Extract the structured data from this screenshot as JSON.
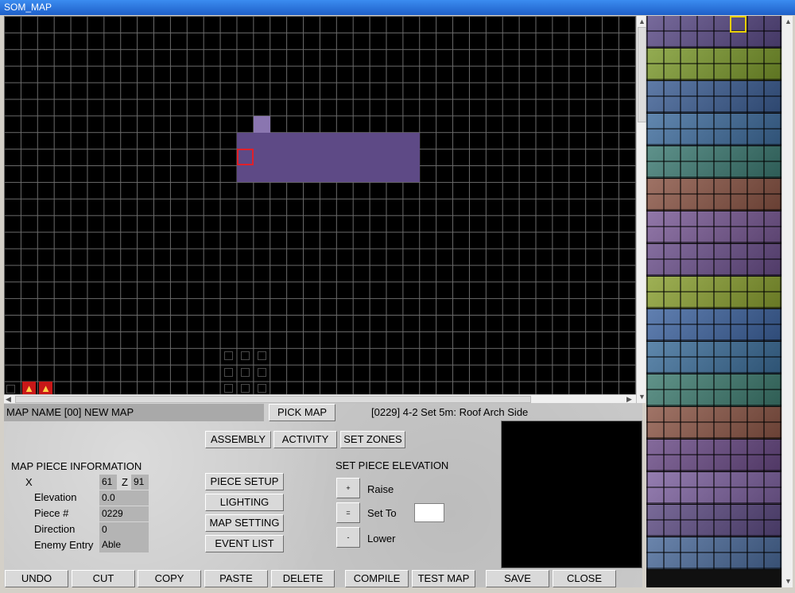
{
  "window": {
    "title": "SOM_MAP"
  },
  "map": {
    "name_label": "MAP NAME [00] NEW MAP",
    "pick_label": "PICK MAP",
    "piece_caption": "[0229] 4-2 Set 5m: Roof Arch Side"
  },
  "modes": [
    "ASSEMBLY",
    "ACTIVITY",
    "SET ZONES"
  ],
  "info": {
    "heading": "MAP PIECE INFORMATION",
    "x_label": "X",
    "x_value": "61",
    "z_label": "Z",
    "z_value": "91",
    "elevation_label": "Elevation",
    "elevation_value": "0.0",
    "piece_label": "Piece #",
    "piece_value": "0229",
    "direction_label": "Direction",
    "direction_value": "0",
    "enemy_label": "Enemy Entry",
    "enemy_value": "Able"
  },
  "side_buttons": [
    "PIECE SETUP",
    "LIGHTING",
    "MAP SETTING",
    "EVENT LIST"
  ],
  "elevation": {
    "heading": "SET PIECE ELEVATION",
    "raise": "Raise",
    "set_to": "Set To",
    "lower": "Lower",
    "raise_symbol": "+",
    "set_symbol": "=",
    "lower_symbol": "-"
  },
  "bottom_buttons": [
    "UNDO",
    "CUT",
    "COPY",
    "PASTE",
    "DELETE",
    "COMPILE",
    "TEST MAP",
    "SAVE",
    "CLOSE"
  ],
  "marker_symbol": "▲",
  "colors": {
    "title_bar": "#1e5fc8",
    "piece_purple": "#5e4a86",
    "selection": "#e0202a",
    "palette_highlight": "#e8d000"
  },
  "palette_bands": [
    "#5a4a86",
    "#7c9a2c",
    "#3c5e94",
    "#3f6d9e",
    "#3c7a72",
    "#8a5444",
    "#7a5a96",
    "#6a4e8a",
    "#8aa030",
    "#3e64a0",
    "#3c6e9a",
    "#3e7c70",
    "#8c5646",
    "#6a4a86",
    "#7e62a0",
    "#5c4a82",
    "#4a6a9a"
  ]
}
